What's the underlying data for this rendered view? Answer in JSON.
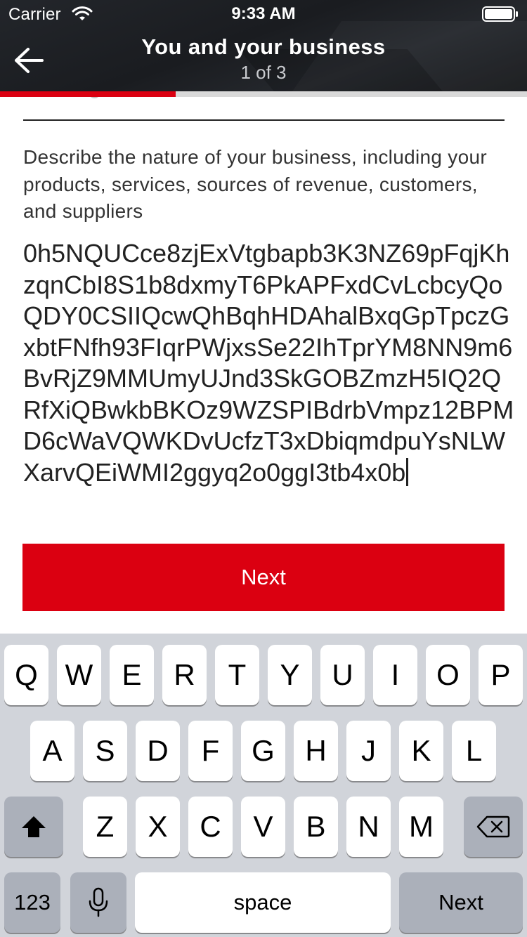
{
  "status_bar": {
    "carrier": "Carrier",
    "time": "9:33 AM"
  },
  "nav": {
    "title": "You and your business",
    "subtitle": "1 of 3"
  },
  "progress": {
    "fraction": 0.333,
    "fill_color": "#db0011"
  },
  "form": {
    "previous_field_value": "finishing",
    "label": "Describe the nature of your business, including your products, services, sources of revenue, customers, and suppliers",
    "value": "0h5NQUCce8zjExVtgbapb3K3NZ69pFqjKhzqnCbI8S1b8dxmyT6PkAPFxdCvLcbcyQoQDY0CSIIQcwQhBqhHDAhalBxqGpTpczGxbtFNfh93FIqrPWjxsSe22IhTprYM8NN9m6BvRjZ9MMUmyUJnd3SkGOBZmzH5IQ2QRfXiQBwkbBKOz9WZSPIBdrbVmpz12BPMD6cWaVQWKDvUcfzT3xDbiqmdpuYsNLWXarvQEiWMI2ggyq2o0ggI3tb4x0b"
  },
  "next_button": {
    "label": "Next"
  },
  "keyboard": {
    "row1": [
      "Q",
      "W",
      "E",
      "R",
      "T",
      "Y",
      "U",
      "I",
      "O",
      "P"
    ],
    "row2": [
      "A",
      "S",
      "D",
      "F",
      "G",
      "H",
      "J",
      "K",
      "L"
    ],
    "row3": [
      "Z",
      "X",
      "C",
      "V",
      "B",
      "N",
      "M"
    ],
    "numbers_key": "123",
    "space_key": "space",
    "return_key": "Next"
  },
  "colors": {
    "brand_red": "#db0011",
    "header_dark": "#1e2125",
    "keyboard_bg": "#d1d4da"
  },
  "icons": {
    "back": "arrow-left-icon",
    "wifi": "wifi-icon",
    "battery": "battery-icon",
    "shift": "shift-icon",
    "delete": "backspace-icon",
    "mic": "microphone-icon"
  }
}
